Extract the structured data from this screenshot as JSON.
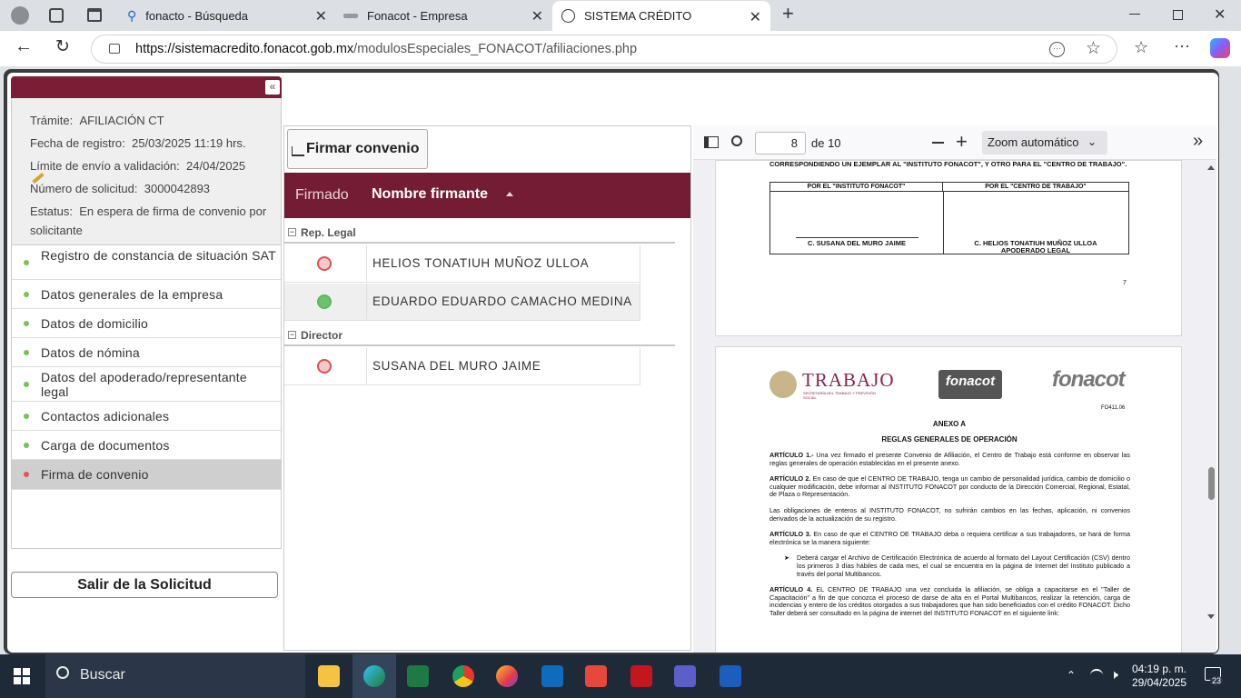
{
  "browser": {
    "tabs": [
      {
        "title": "fonacto - Búsqueda",
        "icon": "search-icon"
      },
      {
        "title": "Fonacot - Empresa",
        "icon": "fonacot-favicon"
      },
      {
        "title": "SISTEMA CRÉDITO",
        "icon": "globe-icon",
        "active": true
      }
    ],
    "url_host": "https://sistemacredito.fonacot.gob.mx",
    "url_path": "/modulosEspeciales_FONACOT/afiliaciones.php"
  },
  "sidebar": {
    "info": [
      {
        "label": "Trámite:",
        "value": "AFILIACIÓN CT"
      },
      {
        "label": "Fecha de registro:",
        "value": "25/03/2025 11:19 hrs."
      },
      {
        "label": "Límite de envío a validación:",
        "value": "24/04/2025"
      },
      {
        "label": "Número de solicitud:",
        "value": "3000042893"
      },
      {
        "label": "Estatus:",
        "value": "En espera de firma de convenio por solicitante"
      }
    ],
    "menu": [
      {
        "label": "Registro de constancia de situación SAT"
      },
      {
        "label": "Datos generales de la empresa"
      },
      {
        "label": "Datos de domicilio"
      },
      {
        "label": "Datos de nómina"
      },
      {
        "label": "Datos del apoderado/representante legal"
      },
      {
        "label": "Contactos adicionales"
      },
      {
        "label": "Carga de documentos"
      },
      {
        "label": "Firma de convenio",
        "active": true
      }
    ],
    "exit_button": "Salir de la Solicitud"
  },
  "signers": {
    "sign_button": "Firmar convenio",
    "col_signed": "Firmado",
    "col_name": "Nombre firmante",
    "groups": [
      {
        "name": "Rep. Legal",
        "rows": [
          {
            "signed": false,
            "name": "HELIOS TONATIUH MUÑOZ ULLOA"
          },
          {
            "signed": true,
            "name": "EDUARDO EDUARDO CAMACHO MEDINA"
          }
        ]
      },
      {
        "name": "Director",
        "rows": [
          {
            "signed": false,
            "name": "SUSANA DEL MURO JAIME"
          }
        ]
      }
    ]
  },
  "pdf": {
    "page": "8",
    "of": "de 10",
    "zoom": "Zoom automático",
    "page1": {
      "top_text": "CORRESPONDIENDO UN EJEMPLAR AL \"INSTITUTO FONACOT\", Y OTRO PARA EL \"CENTRO DE TRABAJO\".",
      "col1": "POR EL \"INSTITUTO FONACOT\"",
      "col2": "POR EL \"CENTRO DE TRABAJO\"",
      "sig1": "C. SUSANA DEL MURO JAIME",
      "sig2": "C. HELIOS TONATIUH MUÑOZ ULLOA",
      "sig2b": "APODERADO LEGAL",
      "page_no": "7"
    },
    "page2": {
      "logo1": "TRABAJO",
      "logo1_sub": "SECRETARÍA DEL TRABAJO Y PREVISIÓN SOCIAL",
      "logo2": "fonacot",
      "logo3": "fonacot",
      "code": "FO411.06",
      "anexo": "ANEXO A",
      "heading": "REGLAS GENERALES DE OPERACIÓN",
      "paras": [
        {
          "b": "ARTÍCULO 1.-",
          "t": " Una vez firmado el presente Convenio de Afiliación, el Centro de Trabajo está conforme en observar las reglas generales de operación establecidas en el presente anexo."
        },
        {
          "b": "ARTÍCULO 2.",
          "t": " En caso de que el CENTRO DE TRABAJO, tenga un cambio de personalidad jurídica, cambio de domicilio o cualquier modificación, debe informar al INSTITUTO FONACOT por conducto de la Dirección Comercial, Regional, Estatal, de Plaza o Representación."
        },
        {
          "b": "",
          "t": "Las obligaciones de enteros al INSTITUTO FONACOT, no sufrirán cambios en las fechas, aplicación, ni convenios derivados de la actualización de su registro."
        },
        {
          "b": "ARTÍCULO 3.",
          "t": " En caso de que el CENTRO DE TRABAJO deba o requiera certificar a sus trabajadores, se hará de forma electrónica se la manera siguiente:"
        },
        {
          "b": "",
          "t": "Deberá cargar el Archivo de Certificación Electrónica de acuerdo al formato del Layout Certificación (CSV) dentro los primeros 3 días hábiles de cada mes, el cual se encuentra en la página de Internet del Instituto publicado a través del portal Multibancos.",
          "bullet": true
        },
        {
          "b": "ARTÍCULO 4.",
          "t": " EL CENTRO DE TRABAJO una vez concluida la afiliación, se obliga a capacitarse en el \"Taller de Capacitación\" a fin de que conozca el proceso de darse de alta en el Portal Multibancos, realizar la retención, carga de incidencias y entero de los créditos otorgados a sus trabajadores que han sido beneficiados con el crédito FONACOT. Dicho Taller deberá ser consultado en la página de internet del INSTITUTO FONACOT en el siguiente link:"
        }
      ]
    }
  },
  "taskbar": {
    "search": "Buscar",
    "time": "04:19 p. m.",
    "date": "29/04/2025",
    "badge": "23"
  }
}
